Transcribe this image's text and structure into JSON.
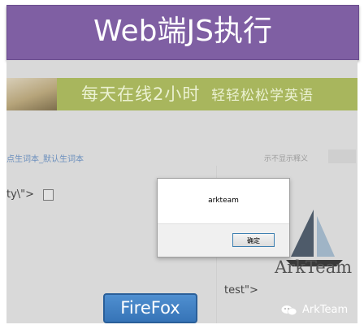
{
  "banner": {
    "title": "Web端JS执行"
  },
  "page": {
    "ad_text_main": "每天在线2小时",
    "ad_text_small": "轻轻松松学英语",
    "link_text": "点生词本_默认生词本",
    "right_hint": "示不显示释义",
    "code_fragment_1": "ty\\\">",
    "code_fragment_2": "test\">"
  },
  "dialog": {
    "message": "arkteam",
    "ok_label": "确定"
  },
  "logo": {
    "text": "ArkTeam"
  },
  "badge": {
    "label": "FireFox"
  },
  "watermark": {
    "text": "ArkTeam",
    "icon": "wechat-icon"
  },
  "colors": {
    "banner_purple": "#7f5fa3",
    "badge_blue": "#3674b7",
    "ad_green": "#a8b65d"
  }
}
